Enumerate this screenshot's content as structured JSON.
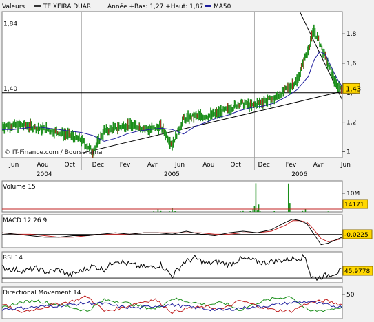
{
  "chart_data": [
    {
      "type": "line",
      "panel": "price",
      "header": {
        "label": "Valeurs",
        "name": "TEIXEIRA DUAR",
        "range_text": "Année +Bas: 1,27 +Haut: 1,87",
        "ma_label": "MA50"
      },
      "source_text": "© IT-Finance.com / Boursorama",
      "month_labels": [
        "Jun",
        "Aou",
        "Oct",
        "Dec",
        "Fev",
        "Avr",
        "Jun",
        "Aou",
        "Oct",
        "Dec",
        "Fev",
        "Avr",
        "Jun"
      ],
      "year_labels": [
        "2004",
        "2005",
        "2006"
      ],
      "yticks": [
        "1",
        "1,2",
        "1,4",
        "1,6",
        "1,8"
      ],
      "ylim": [
        0.96,
        1.95
      ],
      "ref_lines": [
        {
          "value": 1.84,
          "label": "1,84"
        },
        {
          "value": 1.4,
          "label": "1,40"
        }
      ],
      "last_value": 1.43,
      "last_label": "1,43",
      "x": [
        0,
        8,
        16,
        24,
        32,
        40,
        48,
        56,
        64,
        72,
        80,
        88,
        96,
        104,
        112,
        120,
        128,
        136,
        144,
        152,
        160,
        168,
        176,
        184,
        192,
        200,
        208,
        216,
        220,
        224,
        228,
        232,
        236,
        240
      ],
      "close": [
        1.17,
        1.18,
        1.18,
        1.16,
        1.15,
        1.13,
        1.11,
        1.08,
        1.0,
        1.14,
        1.16,
        1.18,
        1.17,
        1.15,
        1.17,
        1.05,
        1.22,
        1.24,
        1.24,
        1.26,
        1.29,
        1.33,
        1.31,
        1.34,
        1.36,
        1.42,
        1.48,
        1.7,
        1.82,
        1.74,
        1.64,
        1.54,
        1.45,
        1.43
      ],
      "ma50": [
        1.15,
        1.15,
        1.16,
        1.17,
        1.16,
        1.15,
        1.14,
        1.13,
        1.11,
        1.07,
        1.09,
        1.12,
        1.14,
        1.15,
        1.16,
        1.15,
        1.12,
        1.17,
        1.2,
        1.23,
        1.25,
        1.28,
        1.3,
        1.31,
        1.33,
        1.37,
        1.42,
        1.51,
        1.62,
        1.68,
        1.66,
        1.58,
        1.5,
        1.44
      ],
      "trend_support": {
        "from": [
          56,
          0.99
        ],
        "to": [
          240,
          1.41
        ]
      },
      "trend_resistance": {
        "from": [
          210,
          1.95
        ],
        "to": [
          242,
          1.31
        ]
      },
      "colors": {
        "price": "#1a8e1a",
        "ma": "#1e1e9e",
        "last_bg": "#ffd700"
      }
    },
    {
      "type": "bar",
      "panel": "volume",
      "label": "Volume 15",
      "ytick": "10M",
      "last_label": "14171",
      "ylim": [
        0,
        12
      ],
      "bars": [
        [
          107,
          0.4
        ],
        [
          110,
          1.2
        ],
        [
          112,
          0.6
        ],
        [
          118,
          0.3
        ],
        [
          120,
          1.5
        ],
        [
          122,
          0.4
        ],
        [
          168,
          0.3
        ],
        [
          170,
          0.6
        ],
        [
          175,
          0.3
        ],
        [
          177,
          1.0
        ],
        [
          178,
          2.4
        ],
        [
          179,
          11.6
        ],
        [
          180,
          0.8
        ],
        [
          181,
          3.0
        ],
        [
          182,
          0.4
        ],
        [
          192,
          0.5
        ],
        [
          202,
          11.5
        ],
        [
          203,
          3.6
        ],
        [
          212,
          0.6
        ],
        [
          214,
          1.0
        ],
        [
          230,
          0.2
        ]
      ],
      "colors": {
        "bar": "#1a8e1a",
        "ma": "#c02020"
      }
    },
    {
      "type": "line",
      "panel": "macd",
      "label": "MACD 12 26 9",
      "last_label": "-0,0225",
      "ylim": [
        -0.09,
        0.13
      ],
      "x": [
        0,
        10,
        20,
        30,
        40,
        50,
        60,
        70,
        80,
        90,
        100,
        110,
        120,
        130,
        140,
        150,
        160,
        170,
        180,
        190,
        200,
        205,
        210,
        215,
        220,
        225,
        230,
        235,
        240
      ],
      "macd": [
        0.01,
        0.0,
        -0.01,
        -0.02,
        -0.02,
        -0.01,
        -0.01,
        0.0,
        0.01,
        0.0,
        0.01,
        0.01,
        0.0,
        0.02,
        0.0,
        -0.01,
        0.01,
        0.02,
        0.01,
        0.03,
        0.08,
        0.1,
        0.09,
        0.07,
        0.0,
        -0.07,
        -0.06,
        -0.04,
        -0.02
      ],
      "signal": [
        0.01,
        0.0,
        0.0,
        -0.01,
        -0.02,
        -0.02,
        -0.01,
        0.0,
        0.0,
        0.0,
        0.01,
        0.01,
        0.01,
        0.01,
        0.01,
        0.0,
        0.0,
        0.01,
        0.01,
        0.02,
        0.06,
        0.09,
        0.09,
        0.08,
        0.03,
        -0.03,
        -0.05,
        -0.04,
        -0.03
      ],
      "colors": {
        "macd": "#000000",
        "signal": "#c02020"
      }
    },
    {
      "type": "line",
      "panel": "rsi",
      "label": "RSI 14",
      "last_label": "45,9778",
      "ylim": [
        20,
        85
      ],
      "levels": [
        30,
        70
      ],
      "x": [
        0,
        8,
        16,
        24,
        32,
        40,
        48,
        56,
        64,
        72,
        80,
        88,
        96,
        104,
        112,
        120,
        128,
        136,
        144,
        152,
        160,
        168,
        176,
        184,
        192,
        200,
        208,
        214,
        218,
        222,
        228,
        234,
        240
      ],
      "rsi": [
        52,
        48,
        45,
        50,
        42,
        48,
        36,
        45,
        55,
        48,
        68,
        60,
        55,
        52,
        58,
        34,
        62,
        72,
        60,
        64,
        58,
        70,
        68,
        62,
        66,
        68,
        72,
        74,
        32,
        30,
        35,
        40,
        46
      ],
      "color": "#000000"
    },
    {
      "type": "line",
      "panel": "dmi",
      "label": "Directional Movement 14",
      "ytick": "50",
      "ylim": [
        0,
        60
      ],
      "x": [
        0,
        12,
        24,
        36,
        48,
        60,
        72,
        84,
        96,
        108,
        120,
        132,
        144,
        156,
        168,
        180,
        192,
        204,
        216,
        228,
        240
      ],
      "series": [
        {
          "color": "#1a8e1a",
          "values": [
            20,
            30,
            34,
            28,
            22,
            14,
            35,
            32,
            24,
            18,
            38,
            32,
            26,
            30,
            16,
            30,
            38,
            42,
            14,
            16,
            22
          ]
        },
        {
          "color": "#c02020",
          "values": [
            28,
            12,
            18,
            26,
            32,
            42,
            14,
            20,
            30,
            36,
            12,
            20,
            22,
            18,
            34,
            24,
            16,
            14,
            30,
            34,
            26
          ]
        },
        {
          "color": "#1e1e9e",
          "values": [
            18,
            20,
            22,
            24,
            26,
            30,
            28,
            22,
            20,
            24,
            26,
            22,
            18,
            16,
            20,
            22,
            26,
            30,
            32,
            26,
            22
          ]
        }
      ]
    }
  ]
}
